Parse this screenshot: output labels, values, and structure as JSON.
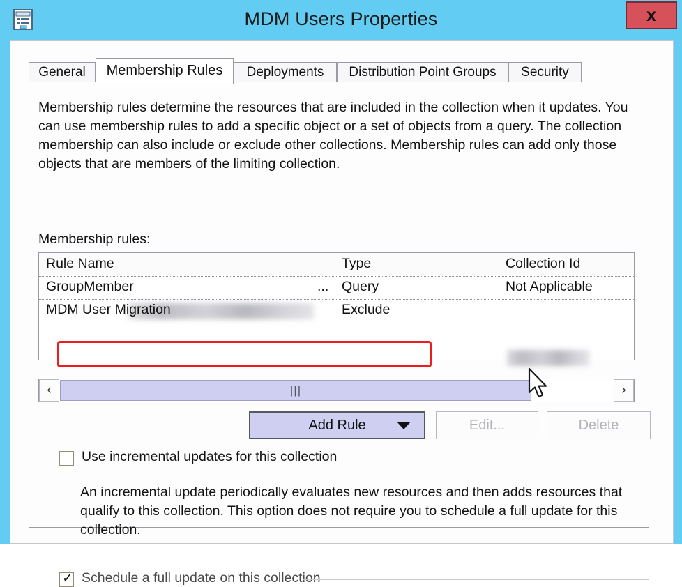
{
  "window": {
    "title": "MDM Users Properties",
    "icon": "properties-window-icon",
    "close_label": "x",
    "titlebar_color": "#63CCF2",
    "close_color": "#D6515A"
  },
  "tabs": [
    {
      "label": "General",
      "active": false
    },
    {
      "label": "Membership Rules",
      "active": true
    },
    {
      "label": "Deployments",
      "active": false
    },
    {
      "label": "Distribution Point Groups",
      "active": false
    },
    {
      "label": "Security",
      "active": false
    }
  ],
  "main": {
    "description": "Membership rules determine the resources that are included in the collection when it updates. You can use membership rules to add a specific object or a set of objects from a query. The collection membership can also include or exclude other collections. Membership rules can add only those objects that are members of the limiting collection.",
    "rules_label": "Membership rules:"
  },
  "table": {
    "columns": [
      "Rule Name",
      "Type",
      "Collection Id"
    ],
    "rows": [
      {
        "name": "GroupMember",
        "name_redacted": true,
        "name_suffix": "...",
        "type": "Query",
        "collection_id": "Not Applicable",
        "collection_redacted": false,
        "selected": false,
        "highlighted": false
      },
      {
        "name": "MDM User Migration",
        "name_redacted": false,
        "name_suffix": "",
        "type": "Exclude",
        "collection_id": "",
        "collection_redacted": true,
        "selected": false,
        "highlighted": true
      }
    ]
  },
  "scrollbar": {
    "left_arrow": "‹",
    "right_arrow": "›",
    "grip": "|||"
  },
  "buttons": {
    "add_rule": "Add Rule",
    "add_rule_caret": "chevron-down-icon",
    "edit": "Edit...",
    "delete": "Delete",
    "edit_enabled": false,
    "delete_enabled": false
  },
  "options": {
    "incremental": {
      "label": "Use incremental updates for this collection",
      "checked": false
    },
    "incremental_description": "An incremental update periodically evaluates new resources and then adds resources that qualify to this collection. This option does not require you to schedule a full update for this collection.",
    "schedule": {
      "label": "Schedule a full update on this collection",
      "checked": true,
      "mark": "✓"
    }
  },
  "annotation": {
    "highlight_color": "#EE1C1C",
    "target_row": "MDM User Migration"
  }
}
